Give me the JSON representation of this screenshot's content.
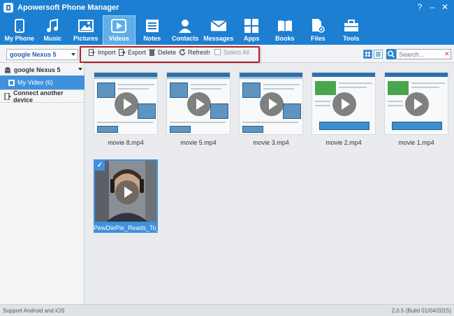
{
  "window": {
    "title": "Apowersoft Phone Manager",
    "controls": [
      "?",
      "–",
      "✕"
    ]
  },
  "maintoolbar": {
    "items": [
      {
        "label": "My Phone",
        "icon": "phone-icon"
      },
      {
        "label": "Music",
        "icon": "music-note-icon"
      },
      {
        "label": "Pictures",
        "icon": "picture-icon"
      },
      {
        "label": "Videos",
        "icon": "video-play-icon"
      },
      {
        "label": "Notes",
        "icon": "notes-icon"
      },
      {
        "label": "Contacts",
        "icon": "contacts-icon"
      },
      {
        "label": "Messages",
        "icon": "envelope-icon"
      },
      {
        "label": "Apps",
        "icon": "apps-grid-icon"
      },
      {
        "label": "Books",
        "icon": "book-icon"
      },
      {
        "label": "Files",
        "icon": "files-icon"
      },
      {
        "label": "Tools",
        "icon": "toolbox-icon"
      }
    ],
    "active": "Videos"
  },
  "subbar": {
    "device_select": "google Nexus 5",
    "actions": {
      "import": "Import",
      "export": "Export",
      "delete": "Delete",
      "refresh": "Refresh",
      "select_all": "Select All"
    },
    "search": {
      "placeholder": "Search..."
    }
  },
  "sidebar": {
    "device": "google Nexus 5",
    "my_video": "My Video (6)",
    "connect": "Connect another device"
  },
  "videos": [
    {
      "name": "movie 8.mp4"
    },
    {
      "name": "movie 5.mp4"
    },
    {
      "name": "movie 3.mp4"
    },
    {
      "name": "movie 2.mp4"
    },
    {
      "name": "movie 1.mp4"
    },
    {
      "name": "PewDiePie_Reads_To_...",
      "selected": true
    }
  ],
  "statusbar": {
    "left": "Support Android and iOS",
    "right": "2.0.5 (Build 01/04/2015)"
  },
  "colors": {
    "accent": "#1d7fd2",
    "highlight_box": "#b61f27",
    "selection": "#3f91dc"
  }
}
